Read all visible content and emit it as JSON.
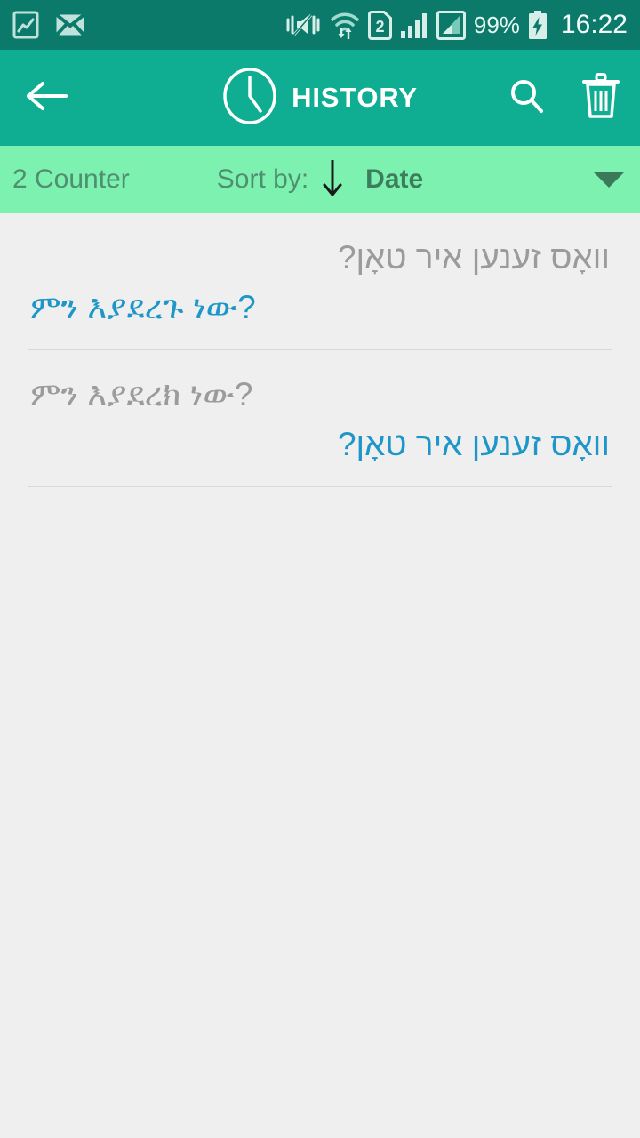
{
  "statusbar": {
    "left_icons": [
      {
        "name": "screenshot-icon"
      },
      {
        "name": "email-icon"
      }
    ],
    "right_icons": [
      {
        "name": "vibrate-mute-icon"
      },
      {
        "name": "wifi-transfer-icon"
      },
      {
        "name": "sim2-icon",
        "label": "2"
      },
      {
        "name": "signal-bars-icon"
      },
      {
        "name": "signal-strength-icon"
      }
    ],
    "battery_percent": "99%",
    "battery_state": "charging",
    "clock": "16:22"
  },
  "appbar": {
    "back_icon": "arrow-left-icon",
    "clock_icon": "clock-icon",
    "title": "HISTORY",
    "search_icon": "search-icon",
    "delete_icon": "trash-icon"
  },
  "sortbar": {
    "counter": "2 Counter",
    "sort_label": "Sort by:",
    "sort_direction_icon": "arrow-down-icon",
    "sort_value": "Date",
    "dropdown_icon": "caret-down-icon"
  },
  "history": {
    "items": [
      {
        "source_text": "וואָס זענען איר טאָן?",
        "source_dir": "rtl",
        "target_text": "ምን እያደረጉ ነው?",
        "target_dir": "ltr"
      },
      {
        "source_text": "ምን እያደረክ ነው?",
        "source_dir": "ltr",
        "target_text": "וואָס זענען איר טאָן?",
        "target_dir": "rtl"
      }
    ]
  },
  "colors": {
    "status_bar": "#0b7a6b",
    "app_bar": "#0fae92",
    "sort_bar": "#7df2b0",
    "background": "#efefef",
    "source_text": "#9b9b9b",
    "target_text": "#1e97c8"
  }
}
